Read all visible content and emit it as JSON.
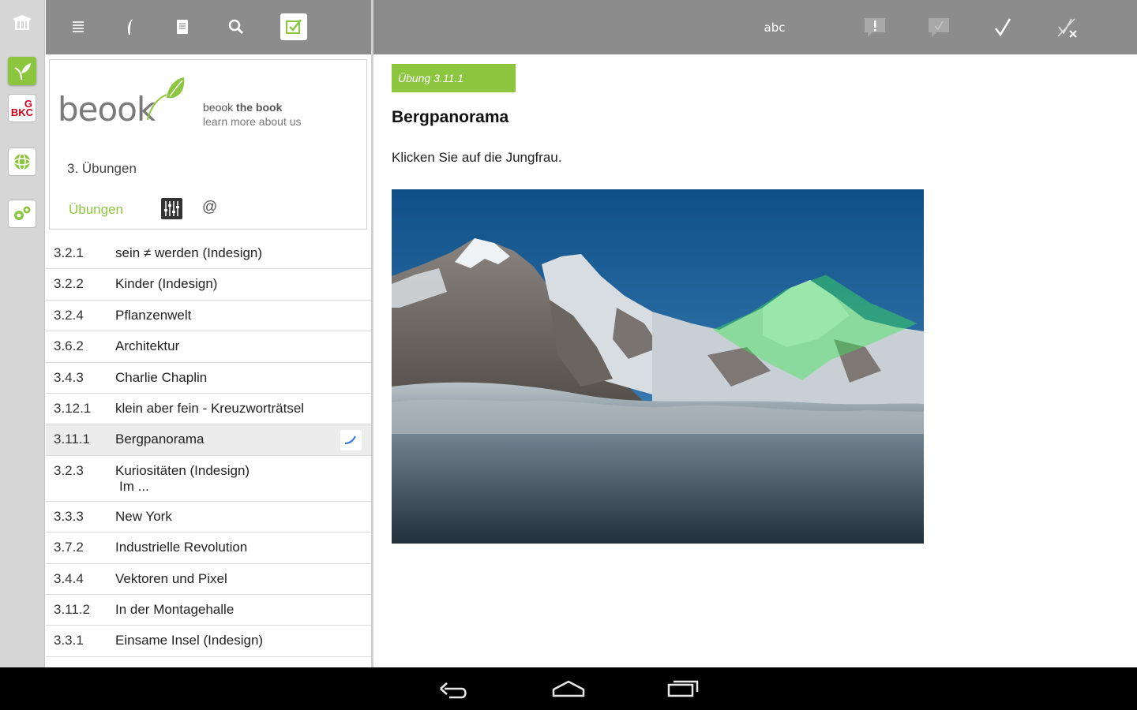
{
  "rail": {
    "items": [
      {
        "name": "home",
        "icon": "library-icon"
      },
      {
        "name": "plant",
        "icon": "plant-icon"
      },
      {
        "name": "bkc",
        "icon": "bkc-logo",
        "letters": [
          "G",
          "BKC"
        ]
      },
      {
        "name": "globe",
        "icon": "globe-icon"
      },
      {
        "name": "settings",
        "icon": "gears-icon"
      }
    ]
  },
  "left_toolbar": {
    "icons": [
      "list-icon",
      "quill-icon",
      "notes-icon",
      "search-icon",
      "exercise-check-icon"
    ],
    "active": "exercise-check-icon"
  },
  "right_toolbar": {
    "abc_label": "abc",
    "icons": [
      "text-mode-icon",
      "hint-icon",
      "verify-icon",
      "check-icon",
      "reset-icon"
    ]
  },
  "book": {
    "logo_word": "beook",
    "tagline_prefix": "beook",
    "tagline_bold": "the book",
    "tagline_2": "learn more about us",
    "chapter": "3. Übungen",
    "tab_label": "Übungen",
    "tab_at": "@"
  },
  "exercises": [
    {
      "num": "3.2.1",
      "title": "sein ≠ werden (Indesign)"
    },
    {
      "num": "3.2.2",
      "title": "Kinder (Indesign)"
    },
    {
      "num": "3.2.4",
      "title": "Pflanzenwelt"
    },
    {
      "num": "3.6.2",
      "title": "Architektur"
    },
    {
      "num": "3.4.3",
      "title": "Charlie Chaplin"
    },
    {
      "num": "3.12.1",
      "title": "klein aber fein - Kreuzworträtsel"
    },
    {
      "num": "3.11.1",
      "title": "Bergpanorama",
      "selected": true
    },
    {
      "num": "3.2.3",
      "title": "Kuriositäten (Indesign)",
      "subtitle": "Im ..."
    },
    {
      "num": "3.3.3",
      "title": "New York"
    },
    {
      "num": "3.7.2",
      "title": "Industrielle Revolution"
    },
    {
      "num": "3.4.4",
      "title": "Vektoren und Pixel"
    },
    {
      "num": "3.11.2",
      "title": "In der Montagehalle"
    },
    {
      "num": "3.3.1",
      "title": "Einsame Insel (Indesign)"
    }
  ],
  "main": {
    "badge": "Übung 3.11.1",
    "title": "Bergpanorama",
    "instruction": "Klicken Sie auf die Jungfrau."
  },
  "colors": {
    "accent": "#8cc63f",
    "toolbar": "#8c8c8c",
    "highlight": "#3ee45a"
  },
  "nav": {
    "icons": [
      "back-icon",
      "home-icon",
      "recents-icon"
    ]
  }
}
